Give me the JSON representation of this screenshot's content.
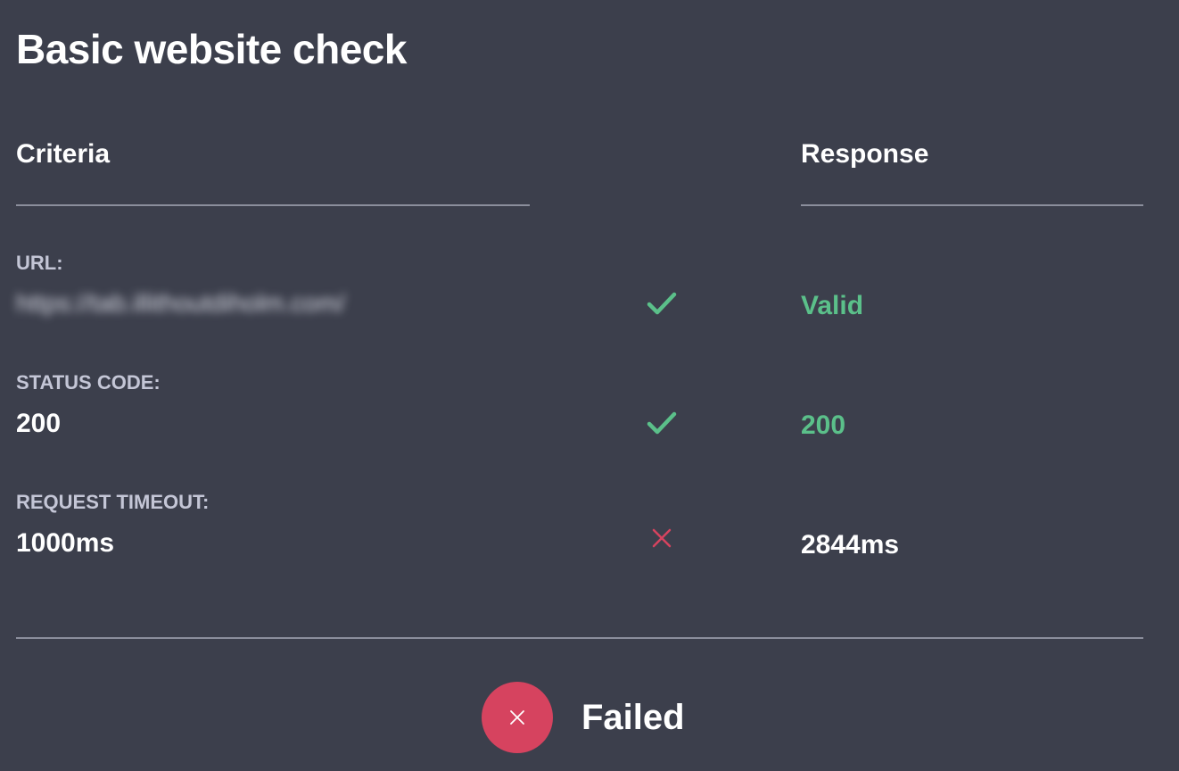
{
  "title": "Basic website check",
  "columns": {
    "criteria": "Criteria",
    "response": "Response"
  },
  "rows": [
    {
      "label": "URL:",
      "criteria_value": "https://tab.illithoutdiholm.com/",
      "status": "pass",
      "status_icon": "check-icon",
      "response": "Valid"
    },
    {
      "label": "STATUS CODE:",
      "criteria_value": "200",
      "status": "pass",
      "status_icon": "check-icon",
      "response": "200"
    },
    {
      "label": "REQUEST TIMEOUT:",
      "criteria_value": "1000ms",
      "status": "fail",
      "status_icon": "cross-icon",
      "response": "2844ms"
    }
  ],
  "result": {
    "label": "Failed",
    "icon": "close-icon",
    "color": "#d6435f"
  },
  "colors": {
    "background": "#3c3f4c",
    "pass": "#5bc08a",
    "fail": "#d6435f"
  }
}
